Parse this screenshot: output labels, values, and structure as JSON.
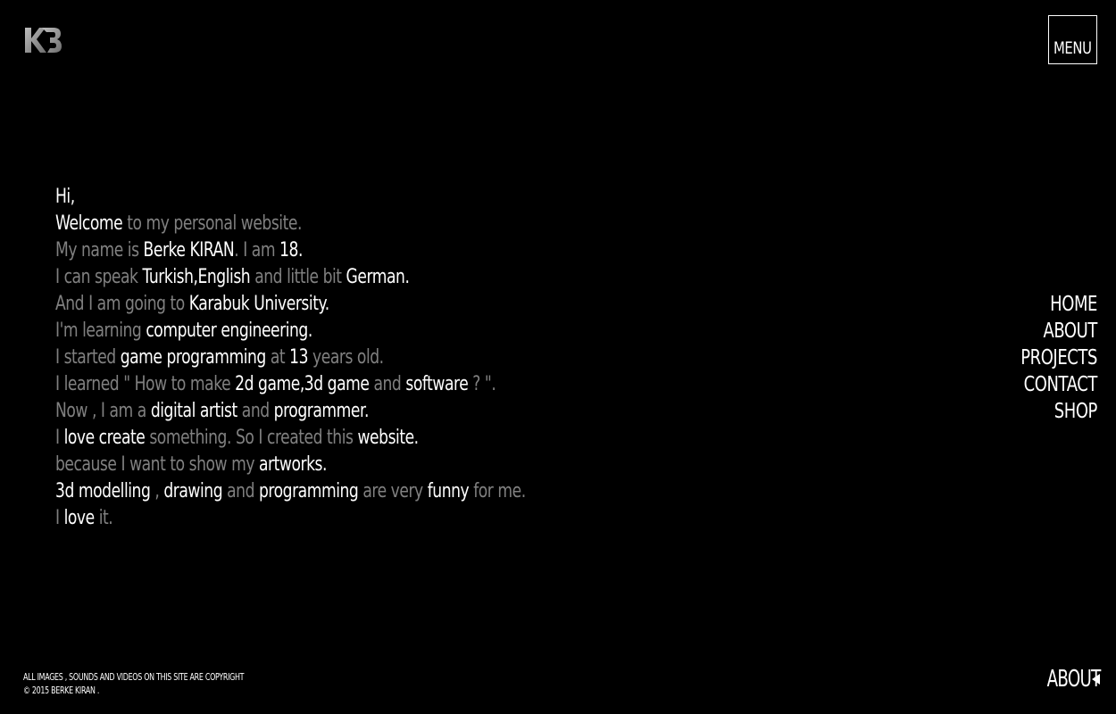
{
  "brand": {
    "logo_text": "KB"
  },
  "header": {
    "menu_label": "MENU"
  },
  "intro": {
    "lines": [
      [
        {
          "t": "Hi,",
          "s": "b"
        }
      ],
      [
        {
          "t": "Welcome",
          "s": "b"
        },
        {
          "t": " to my personal website.",
          "s": "d"
        }
      ],
      [
        {
          "t": "My name is ",
          "s": "d"
        },
        {
          "t": "Berke KIRAN",
          "s": "b"
        },
        {
          "t": ". I am ",
          "s": "d"
        },
        {
          "t": "18.",
          "s": "b"
        }
      ],
      [
        {
          "t": "I can speak ",
          "s": "d"
        },
        {
          "t": "Turkish,English",
          "s": "b"
        },
        {
          "t": " and little bit ",
          "s": "d"
        },
        {
          "t": "German.",
          "s": "b"
        }
      ],
      [
        {
          "t": "And I am going to ",
          "s": "d"
        },
        {
          "t": "Karabuk University.",
          "s": "b"
        }
      ],
      [
        {
          "t": "I'm learning ",
          "s": "d"
        },
        {
          "t": "computer engineering.",
          "s": "b"
        }
      ],
      [
        {
          "t": "I started ",
          "s": "d"
        },
        {
          "t": "game programming",
          "s": "b"
        },
        {
          "t": " at ",
          "s": "d"
        },
        {
          "t": "13",
          "s": "b"
        },
        {
          "t": " years old.",
          "s": "d"
        }
      ],
      [
        {
          "t": "I learned \" How to make ",
          "s": "d"
        },
        {
          "t": "2d game,3d game",
          "s": "b"
        },
        {
          "t": " and ",
          "s": "d"
        },
        {
          "t": "software",
          "s": "b"
        },
        {
          "t": " ? \".",
          "s": "d"
        }
      ],
      [
        {
          "t": "Now , I am a ",
          "s": "d"
        },
        {
          "t": "digital artist",
          "s": "b"
        },
        {
          "t": " and ",
          "s": "d"
        },
        {
          "t": "programmer.",
          "s": "b"
        }
      ],
      [
        {
          "t": "I ",
          "s": "d"
        },
        {
          "t": "love create",
          "s": "b"
        },
        {
          "t": " something. So I created this ",
          "s": "d"
        },
        {
          "t": "website.",
          "s": "b"
        }
      ],
      [
        {
          "t": "because I want to show my ",
          "s": "d"
        },
        {
          "t": "artworks.",
          "s": "b"
        }
      ],
      [
        {
          "t": "3d modelling",
          "s": "b"
        },
        {
          "t": " , ",
          "s": "d"
        },
        {
          "t": "drawing",
          "s": "b"
        },
        {
          "t": " and ",
          "s": "d"
        },
        {
          "t": "programming",
          "s": "b"
        },
        {
          "t": " are very ",
          "s": "d"
        },
        {
          "t": "funny",
          "s": "b"
        },
        {
          "t": " for me.",
          "s": "d"
        }
      ],
      [
        {
          "t": "I ",
          "s": "d"
        },
        {
          "t": "love",
          "s": "b"
        },
        {
          "t": " it.",
          "s": "d"
        }
      ]
    ]
  },
  "nav": {
    "items": [
      {
        "label": "HOME"
      },
      {
        "label": "ABOUT"
      },
      {
        "label": "PROJECTS"
      },
      {
        "label": "CONTACT"
      },
      {
        "label": "SHOP"
      }
    ]
  },
  "footer": {
    "copyright_line1": "ALL IMAGES , SOUNDS AND VIDEOS ON THIS SITE ARE COPYRIGHT",
    "copyright_line2": "© 2015 BERKE KIRAN .",
    "current_page": "ABOUT"
  },
  "colors": {
    "background": "#000000",
    "text_bright": "#ffffff",
    "text_dim": "#808080"
  }
}
